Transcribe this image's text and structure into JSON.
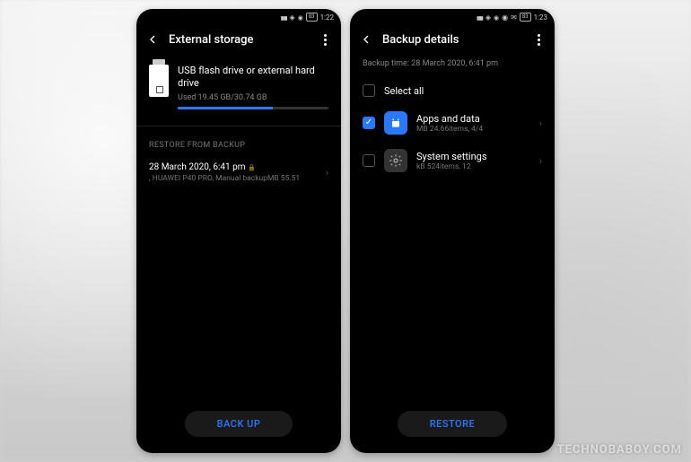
{
  "watermark": "TECHNOBABOY.COM",
  "left": {
    "status": {
      "battery": "83",
      "time": "1:22"
    },
    "title": "External storage",
    "storage": {
      "title": "USB flash drive or external hard drive",
      "used": "Used 19.45 GB/30.74 GB",
      "percent": 63
    },
    "section_label": "RESTORE FROM BACKUP",
    "backup": {
      "title": "28 March 2020, 6:41 pm",
      "sub": ", HUAWEI P40 PRO, Manual backupMB 55.51"
    },
    "button": "BACK UP"
  },
  "right": {
    "status": {
      "battery": "83",
      "time": "1:23"
    },
    "title": "Backup details",
    "backup_time": "Backup time: 28 March 2020, 6:41 pm",
    "select_all": "Select all",
    "items": [
      {
        "title": "Apps and data",
        "sub": "MB 24.66items,  4/4",
        "checked": true
      },
      {
        "title": "System settings",
        "sub": "kB 524items,  12",
        "checked": false
      }
    ],
    "button": "RESTORE"
  }
}
